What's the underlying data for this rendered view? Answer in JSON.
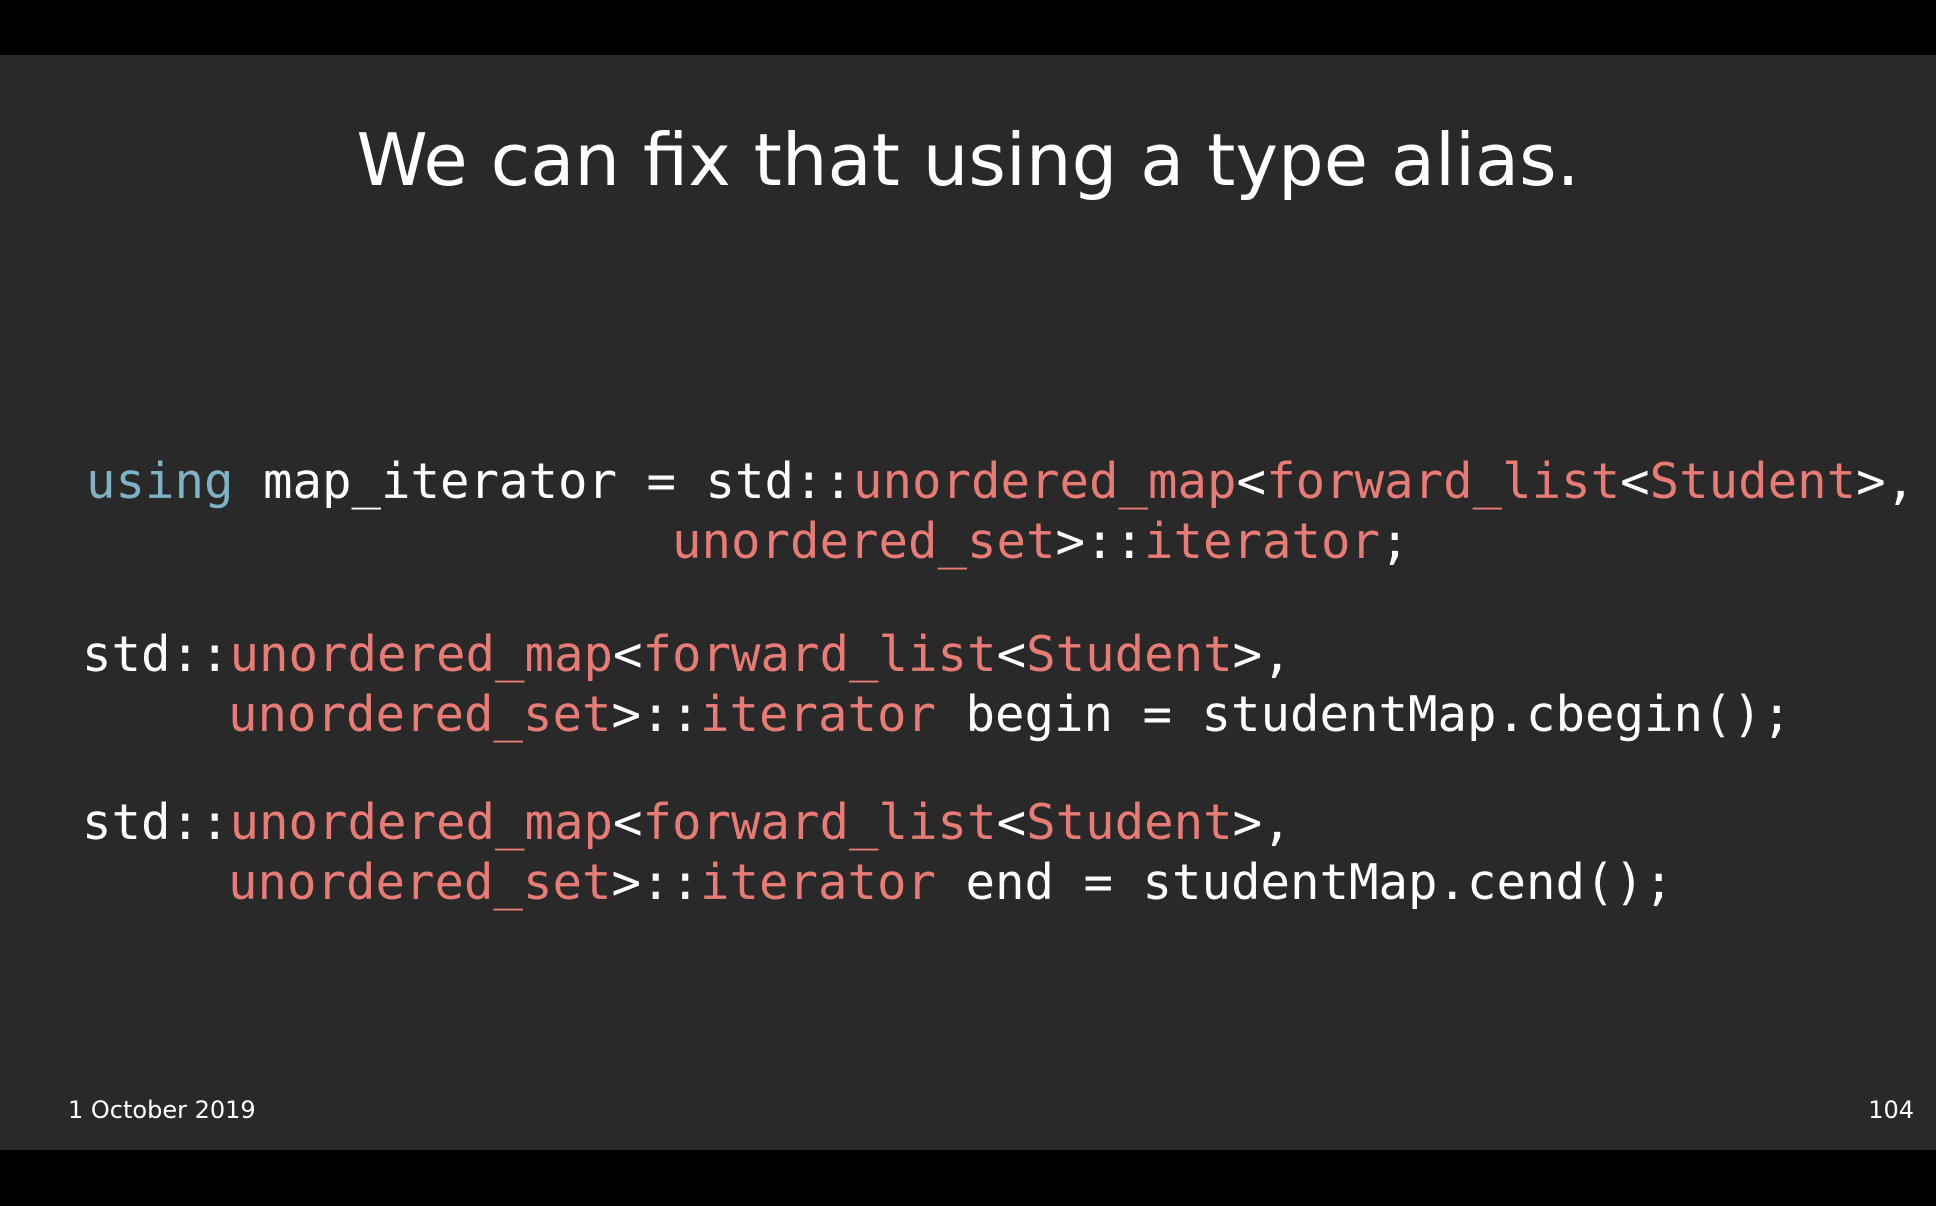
{
  "slide": {
    "title": "We can fix that using a type alias.",
    "footer_date": "1 October 2019",
    "page_number": "104"
  },
  "colors": {
    "background": "#292929",
    "keyword": "#7fb2c4",
    "type": "#e87b76",
    "text": "#ffffff"
  },
  "code": {
    "alias": {
      "line1": {
        "kw_using": "using",
        "t1": " map_iterator = std::",
        "t2": "unordered_map",
        "t3": "<",
        "t4": "forward_list",
        "t5": "<",
        "t6": "Student",
        "t7": ">,"
      },
      "line2": {
        "t1": "unordered_set",
        "t2": ">::",
        "t3": "iterator",
        "t4": ";"
      }
    },
    "begin_decl": {
      "line1": {
        "t1": "std::",
        "t2": "unordered_map",
        "t3": "<",
        "t4": "forward_list",
        "t5": "<",
        "t6": "Student",
        "t7": ">,"
      },
      "line2": {
        "t1": "unordered_set",
        "t2": ">::",
        "t3": "iterator",
        "t4": " begin = studentMap.cbegin();"
      }
    },
    "end_decl": {
      "line1": {
        "t1": "std::",
        "t2": "unordered_map",
        "t3": "<",
        "t4": "forward_list",
        "t5": "<",
        "t6": "Student",
        "t7": ">,"
      },
      "line2": {
        "t1": "unordered_set",
        "t2": ">::",
        "t3": "iterator",
        "t4": " end = studentMap.cend();"
      }
    }
  }
}
